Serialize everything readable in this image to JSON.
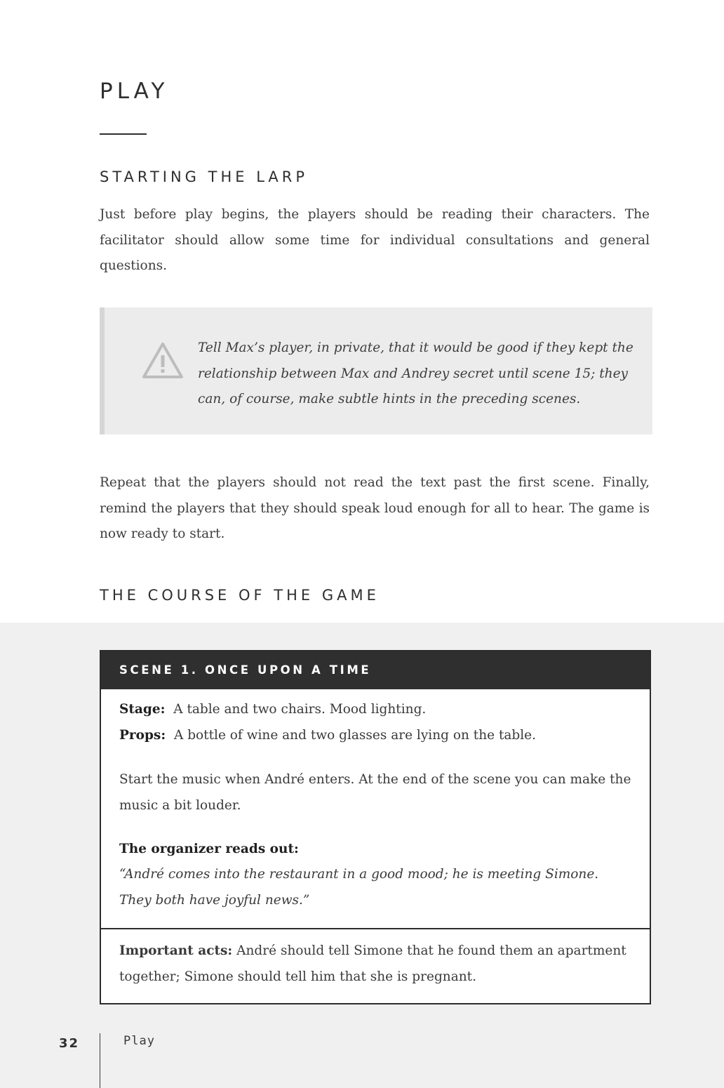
{
  "chapter": {
    "title": "PLAY"
  },
  "section_starting": {
    "heading": "STARTING THE LARP",
    "paragraph": "Just before play begins, the players should be reading their characters. The facilitator should allow some time for individual consultations and general questions."
  },
  "note": {
    "icon": "warning-triangle-icon",
    "text": "Tell Max’s player, in private, that it would be good if they kept the relationship between Max and Andrey secret until scene 15; they can, of course, make subtle hints in the preceding scenes."
  },
  "paragraph_repeat": "Repeat that the players should not read the text past the first scene. Finally, remind the players that they should speak loud enough for all to hear. The game is now ready to start.",
  "section_course": {
    "heading": "THE COURSE OF THE GAME"
  },
  "scene": {
    "title": "SCENE 1. ONCE UPON A TIME",
    "stage_label": "Stage:",
    "stage_value": "A table and two chairs. Mood lighting.",
    "props_label": "Props:",
    "props_value": "A bottle of wine and two glasses are lying on the table.",
    "music_note": "Start the music when André enters. At the end of the scene you can make the music a bit louder.",
    "organizer_label": "The organizer reads out:",
    "organizer_quote": "“André comes into the restaurant in a good mood; he is meeting Simone. They both have joyful news.”",
    "acts_label": "Important acts:",
    "acts_value": "André should tell Simone that he found them an apartment together; Simone should tell him that she is pregnant."
  },
  "footer": {
    "page_number": "32",
    "section_label": "Play"
  }
}
